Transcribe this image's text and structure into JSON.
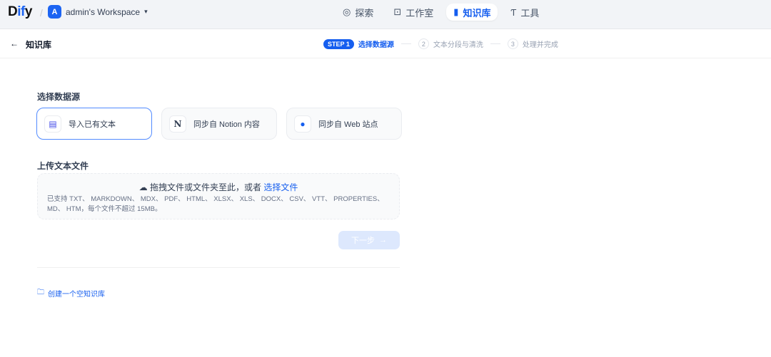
{
  "app": {
    "logo": "Dify",
    "workspace_initial": "A",
    "workspace": "admin's Workspace"
  },
  "nav": [
    {
      "icon": "explore-icon",
      "label": "探索"
    },
    {
      "icon": "robot-icon",
      "label": "工作室"
    },
    {
      "icon": "book-icon",
      "label": "知识库"
    },
    {
      "icon": "hammer-icon",
      "label": "工具"
    }
  ],
  "subheader": {
    "back_label": "知识库"
  },
  "steps": {
    "badge": "STEP 1",
    "current": "选择数据源",
    "s2_num": "2",
    "s2": "文本分段与清洗",
    "s3_num": "3",
    "s3": "处理并完成"
  },
  "datasource": {
    "title": "选择数据源",
    "options": [
      {
        "label": "导入已有文本",
        "selected": true
      },
      {
        "label": "同步自 Notion 内容"
      },
      {
        "label": "同步自 Web 站点"
      }
    ]
  },
  "upload": {
    "title": "上传文本文件",
    "drop_text": "拖拽文件或文件夹至此，或者",
    "select_link": "选择文件",
    "supported": "已支持 TXT、 MARKDOWN、 MDX、 PDF、 HTML、 XLSX、 XLS、 DOCX、 CSV、 VTT、 PROPERTIES、 MD、 HTM，每个文件不超过 15MB。"
  },
  "next_button": "下一步",
  "create_empty": "创建一个空知识库",
  "colors": {
    "accent": "#155eef"
  }
}
